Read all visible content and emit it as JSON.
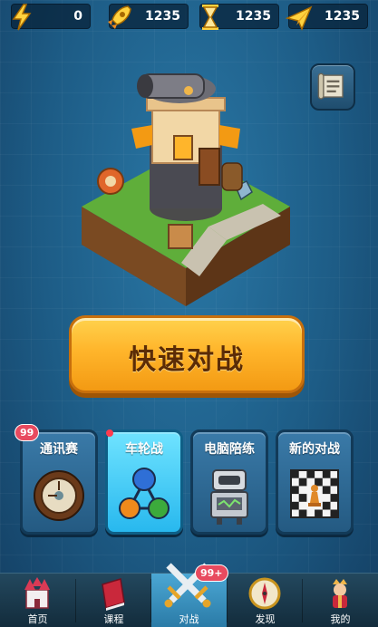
{
  "resources": [
    {
      "icon": "lightning-icon",
      "value": "0"
    },
    {
      "icon": "rocket-icon",
      "value": "1235"
    },
    {
      "icon": "hourglass-icon",
      "value": "1235"
    },
    {
      "icon": "paper-plane-icon",
      "value": "1235"
    }
  ],
  "quick_battle": {
    "label": "快速对战"
  },
  "modes": [
    {
      "title": "通讯赛",
      "badge": "99",
      "icon": "clock-dial-icon"
    },
    {
      "title": "车轮战",
      "badge": "",
      "icon": "network-circles-icon"
    },
    {
      "title": "电脑陪练",
      "badge": "",
      "icon": "robot-icon"
    },
    {
      "title": "新的对战",
      "badge": "",
      "icon": "chessboard-icon"
    }
  ],
  "nav": [
    {
      "label": "首页",
      "icon": "castle-icon"
    },
    {
      "label": "课程",
      "icon": "book-icon"
    },
    {
      "label": "对战",
      "icon": "crossed-swords-icon",
      "badge": "99+"
    },
    {
      "label": "发现",
      "icon": "compass-icon"
    },
    {
      "label": "我的",
      "icon": "king-avatar-icon"
    }
  ],
  "colors": {
    "background": "#1d5c86",
    "quick_button": "#ffb52b",
    "active_card": "#28b8ee",
    "badge": "#e84a5f"
  }
}
